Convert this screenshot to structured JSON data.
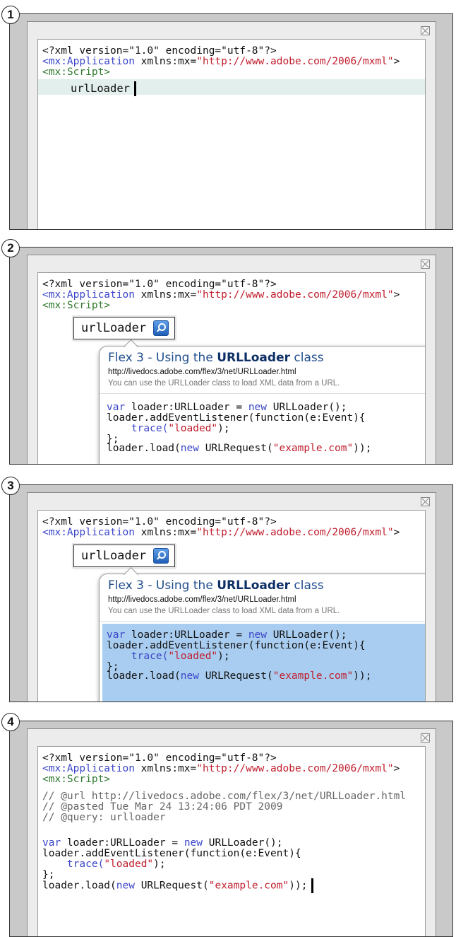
{
  "steps": [
    "1",
    "2",
    "3",
    "4"
  ],
  "xml": {
    "decl": "<?xml version=\"1.0\" encoding=\"utf-8\"?>",
    "app_tag": "<mx:Application",
    "app_attr": " xmlns:mx=",
    "app_url": "\"http://www.adobe.com/2006/mxml\"",
    "app_close": ">",
    "script_tag": "<mx:Script>"
  },
  "typed_query": "urlLoader",
  "popup": {
    "title_prefix": "Flex 3 - Using the ",
    "title_bold": "URLLoader",
    "title_suffix": " class",
    "url": "http://livedocs.adobe.com/flex/3/net/URLLoader.html",
    "description": "You can use the URLLoader class to load XML data from a URL."
  },
  "code": {
    "l1a": "var",
    "l1b": " loader:URLLoader = ",
    "l1c": "new",
    "l1d": " URLLoader();",
    "l2": "loader.addEventListener(function(e:Event){",
    "l3a": "    trace(",
    "l3b": "\"loaded\"",
    "l3c": ");",
    "l4": "};",
    "l5a": "loader.load(",
    "l5b": "new",
    "l5c": " URLRequest(",
    "l5d": "\"example.com\"",
    "l5e": "));"
  },
  "comments": {
    "url": "// @url http://livedocs.adobe.com/flex/3/net/URLLoader.html",
    "pasted": "// @pasted Tue Mar 24 13:24:06 PDT 2009",
    "query": "// @query: urlloader"
  },
  "colors": {
    "keyword": "#3a45c8",
    "string": "#c01d2c",
    "tag": "#2f7a2f",
    "selection": "#a9cdf0",
    "current_line": "#e2efec"
  }
}
